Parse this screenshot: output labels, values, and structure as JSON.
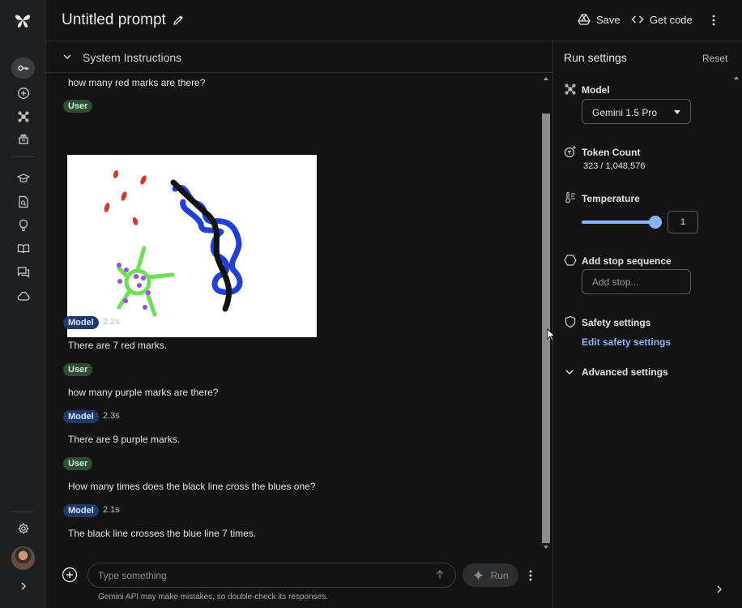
{
  "header": {
    "title": "Untitled prompt",
    "save_label": "Save",
    "get_code_label": "Get code"
  },
  "system_instructions": {
    "label": "System Instructions"
  },
  "chat": {
    "clipped_text": "how many red marks are there?",
    "messages": [
      {
        "role": "User"
      },
      {
        "role": "Model",
        "time": "2.2s",
        "text": "There are 7 red marks."
      },
      {
        "role": "User",
        "text": "how many purple marks are there?"
      },
      {
        "role": "Model",
        "time": "2.3s",
        "text": "There are 9 purple marks."
      },
      {
        "role": "User",
        "text": "How many times does the black line cross the blues one?"
      },
      {
        "role": "Model",
        "time": "2.1s",
        "text": "The black line crosses the blue line 7 times."
      }
    ]
  },
  "composer": {
    "placeholder": "Type something",
    "run_label": "Run",
    "disclaimer": "Gemini API may make mistakes, so double-check its responses."
  },
  "run_settings": {
    "title": "Run settings",
    "reset_label": "Reset",
    "model_label": "Model",
    "model_value": "Gemini 1.5 Pro",
    "token_count_label": "Token Count",
    "token_count_value": "323 / 1,048,576",
    "temperature_label": "Temperature",
    "temperature_value": "1",
    "temperature_fraction": 1.0,
    "stop_sequence_label": "Add stop sequence",
    "stop_sequence_placeholder": "Add stop...",
    "safety_label": "Safety settings",
    "safety_link": "Edit safety settings",
    "advanced_label": "Advanced settings"
  },
  "colors": {
    "accent": "#8ab4f8",
    "user_chip": "#2c4e34",
    "model_chip": "#1d3a6b",
    "background": "#131314"
  },
  "icons": [
    "gemini-logo-icon",
    "key-icon",
    "add-circle-icon",
    "gallery-icon",
    "library-icon",
    "school-icon",
    "docs-search-icon",
    "lightbulb-icon",
    "book-icon",
    "forum-icon",
    "cloud-icon",
    "settings-icon",
    "chevron-right-icon",
    "pencil-icon",
    "drive-icon",
    "code-icon",
    "more-vert-icon",
    "sparkle-icon",
    "send-icon",
    "token-icon",
    "thermometer-icon",
    "hexagon-icon",
    "shield-icon",
    "chevron-down-icon"
  ]
}
